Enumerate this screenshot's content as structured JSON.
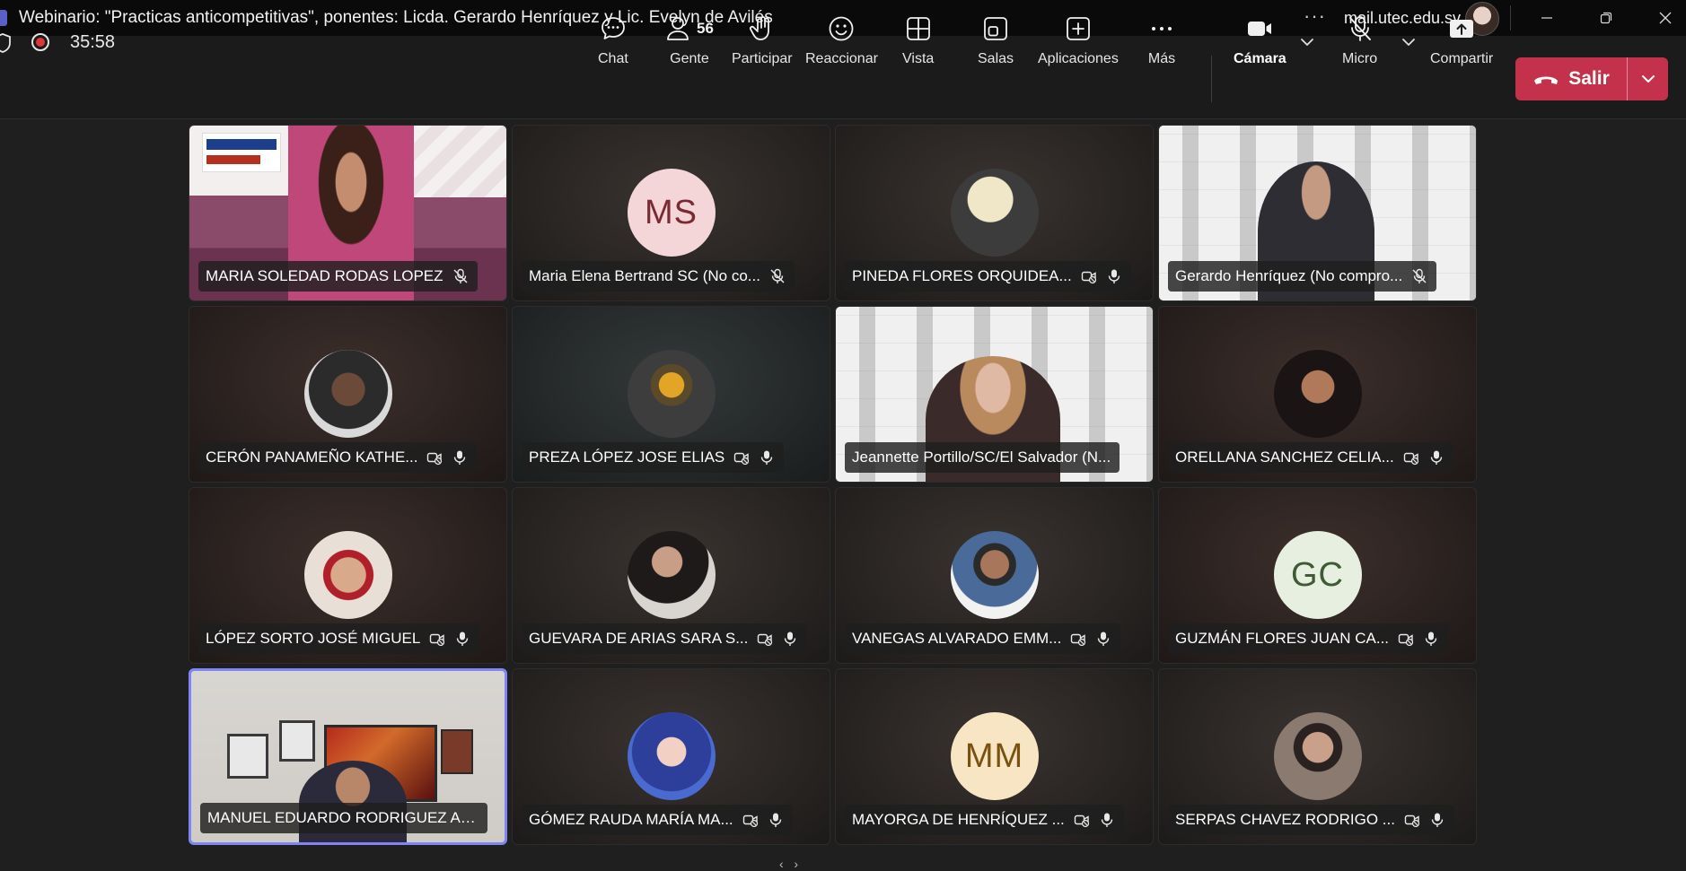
{
  "window": {
    "title": "Webinario: \"Practicas anticompetitivas\", ponentes: Licda. Gerardo Henríquez y Lic. Evelyn de Avilés",
    "more_label": "···",
    "account": "mail.utec.edu.sv"
  },
  "meeting": {
    "timer": "35:58",
    "recording": true
  },
  "toolbar": {
    "chat": "Chat",
    "people": "Gente",
    "people_count": "56",
    "raise_hand": "Participar",
    "react": "Reaccionar",
    "view": "Vista",
    "rooms": "Salas",
    "apps": "Aplicaciones",
    "more": "Más",
    "camera": "Cámara",
    "mic": "Micro",
    "share": "Compartir",
    "leave": "Salir"
  },
  "colors": {
    "accent": "#7f85f5",
    "leave": "#c4314b",
    "recording": "#e0353b"
  },
  "participants": [
    {
      "name": "MARIA SOLEDAD RODAS LOPEZ",
      "type": "video",
      "icons": [
        "mic-off-icon"
      ]
    },
    {
      "name": "Maria Elena Bertrand SC (No co...",
      "type": "initials",
      "initials": "MS",
      "avatar_bg": "#f4d6d8",
      "avatar_fg": "#7a2a33",
      "icons": [
        "mic-off-icon"
      ]
    },
    {
      "name": "PINEDA FLORES ORQUIDEA...",
      "type": "photo",
      "icons": [
        "camera-off-icon",
        "mic-icon"
      ]
    },
    {
      "name": "Gerardo Henríquez (No compro...",
      "type": "video",
      "icons": [
        "mic-off-icon"
      ]
    },
    {
      "name": "CERÓN PANAMEÑO KATHE...",
      "type": "photo",
      "icons": [
        "camera-off-icon",
        "mic-icon"
      ]
    },
    {
      "name": "PREZA LÓPEZ JOSE ELIAS",
      "type": "photo",
      "icons": [
        "camera-off-icon",
        "mic-icon"
      ]
    },
    {
      "name": "Jeannette Portillo/SC/El Salvador (N...",
      "type": "video",
      "icons": []
    },
    {
      "name": "ORELLANA SANCHEZ CELIA...",
      "type": "photo",
      "icons": [
        "camera-off-icon",
        "mic-icon"
      ]
    },
    {
      "name": "LÓPEZ SORTO JOSÉ MIGUEL",
      "type": "photo",
      "icons": [
        "camera-off-icon",
        "mic-icon"
      ]
    },
    {
      "name": "GUEVARA DE ARIAS SARA S...",
      "type": "photo",
      "icons": [
        "camera-off-icon",
        "mic-icon"
      ]
    },
    {
      "name": "VANEGAS ALVARADO EMM...",
      "type": "photo",
      "icons": [
        "camera-off-icon",
        "mic-icon"
      ]
    },
    {
      "name": "GUZMÁN FLORES JUAN CA...",
      "type": "initials",
      "initials": "GC",
      "avatar_bg": "#e6efe0",
      "avatar_fg": "#3f5a34",
      "icons": [
        "camera-off-icon",
        "mic-icon"
      ]
    },
    {
      "name": "MANUEL EDUARDO RODRIGUEZ ARI...",
      "type": "video",
      "active": true,
      "icons": []
    },
    {
      "name": "GÓMEZ RAUDA MARÍA MA...",
      "type": "photo",
      "icons": [
        "camera-off-icon",
        "mic-icon"
      ]
    },
    {
      "name": "MAYORGA DE HENRÍQUEZ ...",
      "type": "initials",
      "initials": "MM",
      "avatar_bg": "#f7e5c3",
      "avatar_fg": "#7a5210",
      "icons": [
        "camera-off-icon",
        "mic-icon"
      ]
    },
    {
      "name": "SERPAS CHAVEZ RODRIGO ...",
      "type": "photo",
      "icons": [
        "camera-off-icon",
        "mic-icon"
      ]
    }
  ]
}
